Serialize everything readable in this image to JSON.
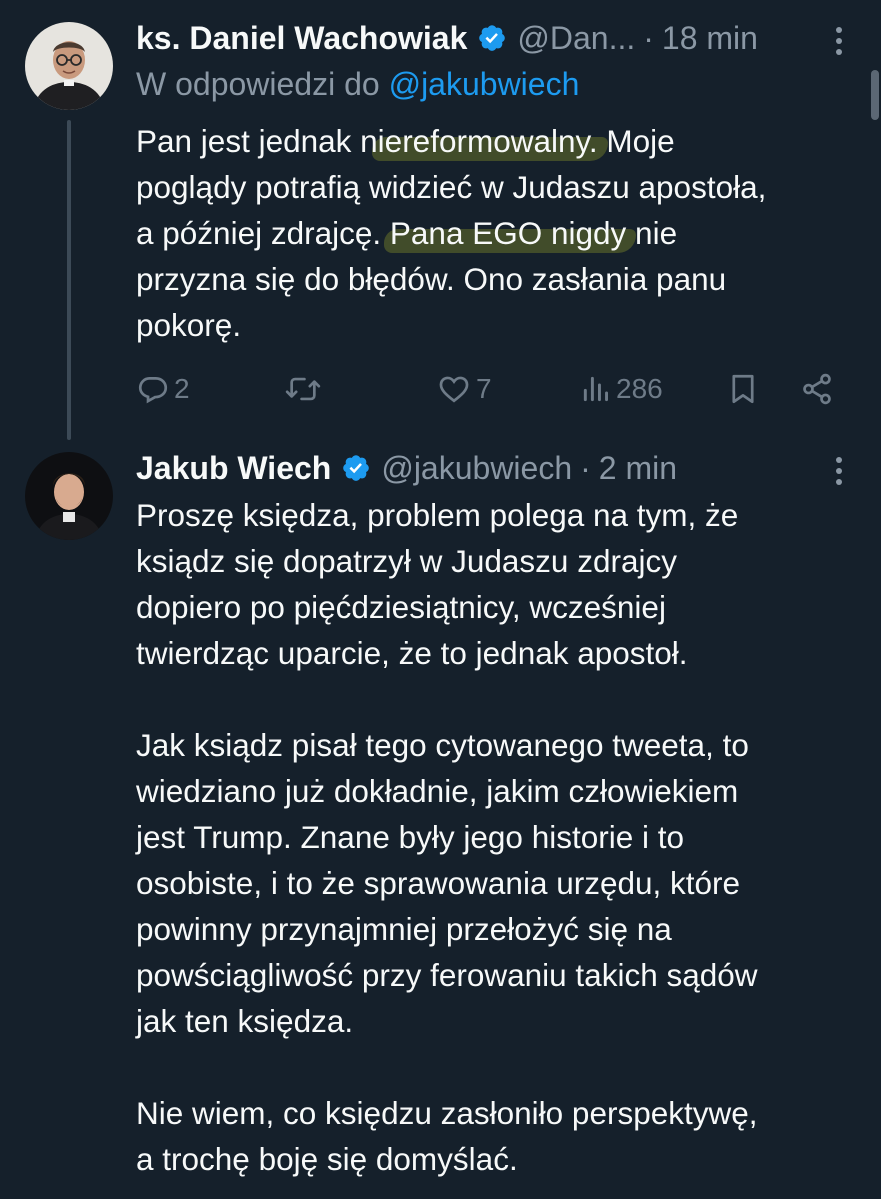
{
  "tweet1": {
    "name": "ks. Daniel Wachowiak",
    "handle": "@Dan...",
    "separator": "·",
    "time": "18 min",
    "replying_prefix": "W odpowiedzi do",
    "replying_to": "@jakubwiech",
    "body_lines": {
      "l1_a": "Pan jest jednak n",
      "l1_hl": "iereformowalny.",
      "l1_b": " Moje",
      "l2": "poglądy potrafią widzieć w Judaszu apostoła,",
      "l3_a": "a później zdrajcę. ",
      "l3_hl": "Pana EGO nigdy",
      "l3_b": " nie",
      "l4": "przyzna się do błędów. Ono zasłania panu",
      "l5": "pokorę."
    },
    "actions": {
      "reply_count": "2",
      "retweet_count": "",
      "like_count": "7",
      "views_count": "286"
    }
  },
  "tweet2": {
    "name": "Jakub Wiech",
    "handle": "@jakubwiech",
    "separator": "·",
    "time": "2 min",
    "body_lines": {
      "l1": "Proszę księdza, problem polega na tym, że",
      "l2": "ksiądz się dopatrzył w Judaszu zdrajcy",
      "l3": "dopiero po pięćdziesiątnicy, wcześniej",
      "l4": "twierdząc uparcie, że to jednak apostoł.",
      "l5": "Jak ksiądz pisał tego cytowanego tweeta, to",
      "l6": "wiedziano już dokładnie, jakim człowiekiem",
      "l7": "jest Trump. Znane były jego historie i to",
      "l8": "osobiste, i to że sprawowania urzędu, które",
      "l9": "powinny przynajmniej przełożyć się na",
      "l10": "powściągliwość przy ferowaniu takich sądów",
      "l11": "jak ten księdza.",
      "l12": "Nie wiem, co księdzu zasłoniło perspektywę,",
      "l13": "a trochę boję się domyślać."
    }
  },
  "colors": {
    "background": "#15202b",
    "text_primary": "#f7f9f9",
    "text_secondary": "#8b98a5",
    "accent": "#1d9bf0",
    "highlight": "#b4be28"
  },
  "icons": {
    "verified": "verified-badge-icon",
    "more": "more-dots-icon",
    "reply": "reply-icon",
    "retweet": "retweet-icon",
    "like": "heart-icon",
    "views": "views-chart-icon",
    "bookmark": "bookmark-icon",
    "share": "share-icon"
  }
}
